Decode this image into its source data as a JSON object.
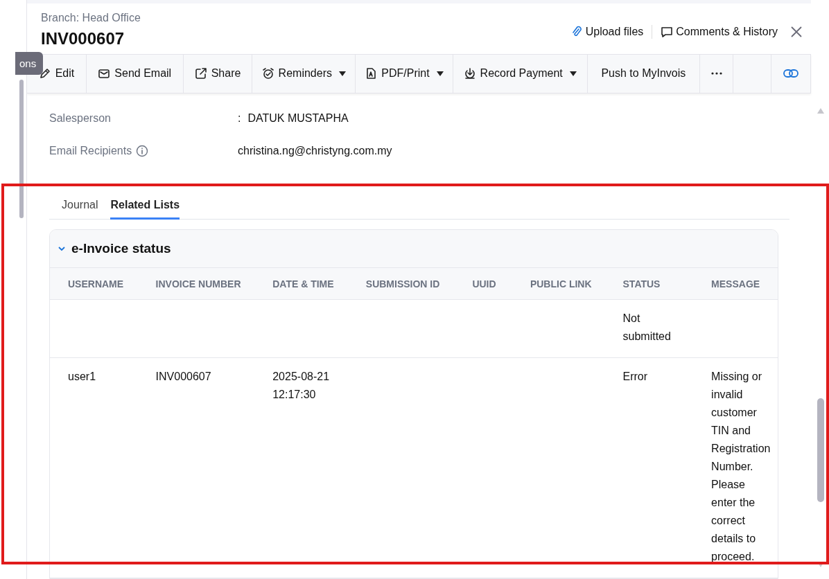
{
  "tooltip": {
    "text": "ons"
  },
  "header": {
    "branch": "Branch: Head Office",
    "title": "INV000607",
    "actions": [
      {
        "kind": "upload",
        "label": "Upload files"
      },
      {
        "kind": "comments",
        "label": "Comments & History"
      }
    ]
  },
  "toolbar": [
    {
      "kind": "edit",
      "label": "Edit",
      "dropdown": false
    },
    {
      "kind": "email",
      "label": "Send Email",
      "dropdown": false
    },
    {
      "kind": "share",
      "label": "Share",
      "dropdown": false
    },
    {
      "kind": "reminder",
      "label": "Reminders",
      "dropdown": true
    },
    {
      "kind": "pdf",
      "label": "PDF/Print",
      "dropdown": true
    },
    {
      "kind": "payment",
      "label": "Record Payment",
      "dropdown": true
    },
    {
      "kind": "text",
      "label": "Push to MyInvois",
      "dropdown": false
    },
    {
      "kind": "more",
      "dropdown": false
    },
    {
      "kind": "blank",
      "dropdown": false
    },
    {
      "kind": "link",
      "dropdown": false
    }
  ],
  "details": [
    {
      "label": "Salesperson",
      "info": false,
      "separator": ":",
      "value": "DATUK MUSTAPHA"
    },
    {
      "label": "Email Recipients",
      "info": true,
      "value": "christina.ng@christyng.com.my"
    }
  ],
  "tabs": [
    {
      "label": "Journal",
      "selected": false
    },
    {
      "label": "Related Lists",
      "selected": true
    }
  ],
  "section": {
    "title": "e-Invoice status",
    "expanded": true,
    "table": {
      "columns": [
        "USERNAME",
        "INVOICE NUMBER",
        "DATE & TIME",
        "SUBMISSION ID",
        "UUID",
        "PUBLIC LINK",
        "STATUS",
        "MESSAGE"
      ],
      "rows": [
        [
          null,
          null,
          null,
          null,
          null,
          null,
          "Not submitted",
          null
        ],
        [
          "user1",
          "INV000607",
          "2025-08-21 12:17:30",
          null,
          null,
          null,
          "Error",
          "Missing or invalid customer TIN and Registration Number. Please enter the correct details to proceed."
        ]
      ]
    }
  }
}
